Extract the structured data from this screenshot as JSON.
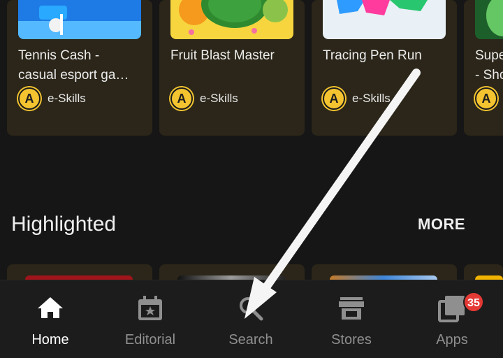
{
  "cards": [
    {
      "title_line1": "Tennis Cash -",
      "title_line2": "casual esport ga…",
      "developer": "e-Skills",
      "dev_logo_letter": "A",
      "thumb_colors": [
        "#1e7be6",
        "#54b9ff"
      ]
    },
    {
      "title_line1": "Fruit Blast Master",
      "title_line2": "",
      "developer": "e-Skills",
      "dev_logo_letter": "A",
      "thumb_colors": [
        "#f7d53f",
        "#f0b72a"
      ]
    },
    {
      "title_line1": "Tracing Pen Run",
      "title_line2": "",
      "developer": "e-Skills",
      "dev_logo_letter": "A",
      "thumb_colors": [
        "#e9f0f6",
        "#d4e4f0"
      ]
    },
    {
      "title_line1": "Supe",
      "title_line2": "- Sho",
      "developer": "",
      "dev_logo_letter": "A",
      "thumb_colors": [
        "#3aa84a",
        "#64c764"
      ]
    }
  ],
  "section": {
    "title": "Highlighted",
    "more_label": "MORE"
  },
  "peek_colors": [
    "#a1141b",
    "#9c9c9c",
    "#3e86d8",
    "#f2b400"
  ],
  "bottom_nav": {
    "items": [
      {
        "label": "Home",
        "icon": "home-icon",
        "active": true
      },
      {
        "label": "Editorial",
        "icon": "calendar-star-icon",
        "active": false
      },
      {
        "label": "Search",
        "icon": "search-icon",
        "active": false
      },
      {
        "label": "Stores",
        "icon": "store-icon",
        "active": false
      },
      {
        "label": "Apps",
        "icon": "apps-stack-icon",
        "active": false
      }
    ],
    "apps_badge": "35"
  },
  "colors": {
    "accent_badge": "#e53935",
    "dev_logo": "#f4c430",
    "active_label": "#ffffff",
    "inactive_label": "#8f8f8f"
  }
}
